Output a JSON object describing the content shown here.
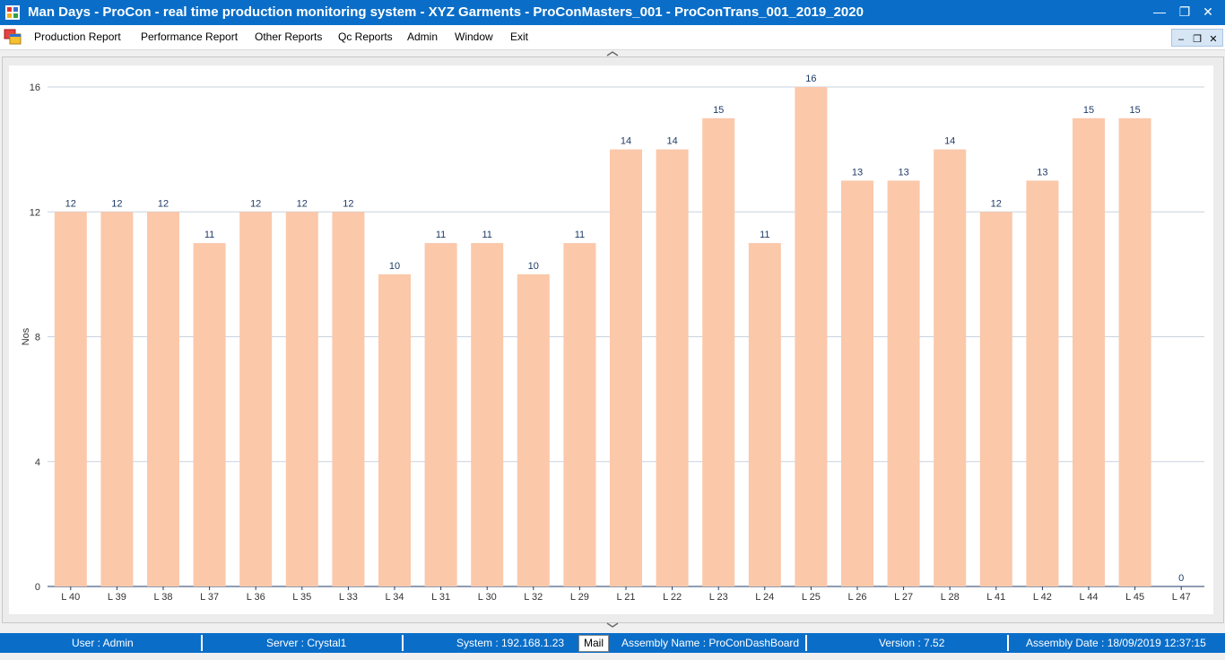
{
  "window": {
    "title": "Man Days - ProCon - real time production monitoring system - XYZ Garments - ProConMasters_001 - ProConTrans_001_2019_2020",
    "minimize_icon": "minimize-icon",
    "restore_icon": "restore-icon",
    "close_icon": "close-icon"
  },
  "menu": {
    "items": [
      "Production Report",
      "Performance Report",
      "Other Reports",
      "Qc Reports",
      "Admin",
      "Window",
      "Exit"
    ]
  },
  "chart_data": {
    "type": "bar",
    "ylabel": "Nos",
    "ylim": [
      0,
      16
    ],
    "yticks": [
      0,
      4,
      8,
      12,
      16
    ],
    "grid": true,
    "bar_color": "#fbc8aa",
    "label_color": "#1f3b66",
    "categories": [
      "L 40",
      "L 39",
      "L 38",
      "L 37",
      "L 36",
      "L 35",
      "L 33",
      "L 34",
      "L 31",
      "L 30",
      "L 32",
      "L 29",
      "L 21",
      "L 22",
      "L 23",
      "L 24",
      "L 25",
      "L 26",
      "L 27",
      "L 28",
      "L 41",
      "L 42",
      "L 44",
      "L 45",
      "L 47"
    ],
    "values": [
      12,
      12,
      12,
      11,
      12,
      12,
      12,
      10,
      11,
      11,
      10,
      11,
      14,
      14,
      15,
      11,
      16,
      13,
      13,
      14,
      12,
      13,
      15,
      15,
      0
    ]
  },
  "status": {
    "user": "User : Admin",
    "server": "Server : Crystal1",
    "system": "System : 192.168.1.23",
    "mail": "Mail",
    "assembly_name": "Assembly Name : ProConDashBoard",
    "version": "Version : 7.52",
    "assembly_date": "Assembly Date : 18/09/2019 12:37:15"
  },
  "colors": {
    "titlebar": "#0a6ec9",
    "statusbar": "#0a6ec9",
    "bar": "#fbc8aa"
  }
}
